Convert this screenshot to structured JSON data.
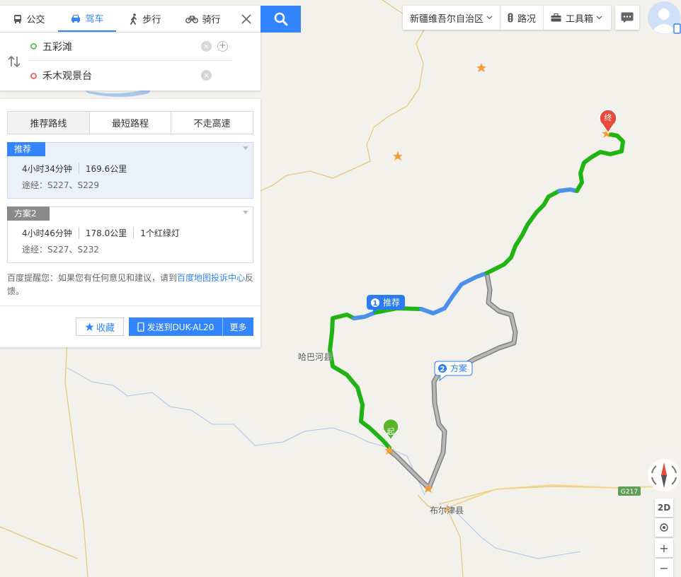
{
  "modes": [
    {
      "label": "公交",
      "icon": "bus-icon",
      "active": false
    },
    {
      "label": "驾车",
      "icon": "car-icon",
      "active": true
    },
    {
      "label": "步行",
      "icon": "walk-icon",
      "active": false
    },
    {
      "label": "骑行",
      "icon": "bike-icon",
      "active": false
    }
  ],
  "origin": "五彩滩",
  "destination": "禾木观景台",
  "route_tabs": [
    "推荐路线",
    "最短路程",
    "不走高速"
  ],
  "plans": [
    {
      "tag": "推荐",
      "time": "4小时34分钟",
      "distance": "169.6公里",
      "extra": "",
      "via": "途经：S227、S229"
    },
    {
      "tag": "方案2",
      "time": "4小时46分钟",
      "distance": "178.0公里",
      "extra": "1个红绿灯",
      "via": "途经：S227、S232"
    }
  ],
  "notice": {
    "prefix": "百度提醒您：如果您有任何意见和建议，请到",
    "link": "百度地图投诉中心",
    "suffix": "反馈。"
  },
  "buttons": {
    "favorite": "收藏",
    "send": "发送到DUK-AL20",
    "more": "更多"
  },
  "toolbar": {
    "region": "新疆维吾尔自治区",
    "traffic": "路况",
    "tools": "工具箱"
  },
  "map": {
    "labels": {
      "habahe": "哈巴河县",
      "burqin": "布尔津县",
      "road": "G217"
    },
    "markers": {
      "start": "起",
      "end": "终",
      "route1": "推荐",
      "route1_num": "1",
      "route2": "方案",
      "route2_num": "2"
    }
  },
  "controls": {
    "view": "2D",
    "zoom_in": "+",
    "zoom_out": "−"
  },
  "colors": {
    "accent": "#3385ff",
    "route_green": "#1fb313",
    "route_slow": "#4d90ea",
    "route_alt": "#a6a6a6",
    "start_green": "#5ab52b",
    "end_red": "#e84a3c"
  }
}
